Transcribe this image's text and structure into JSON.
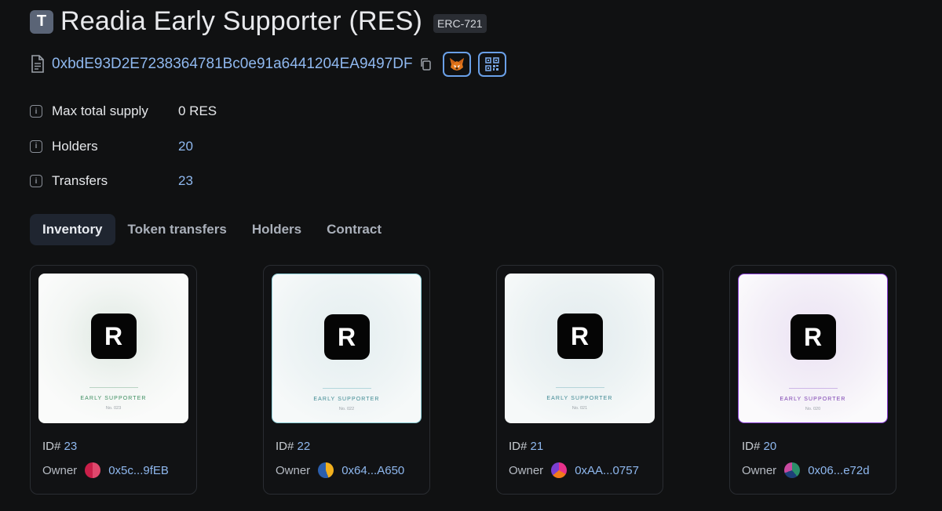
{
  "token": {
    "avatar_letter": "T",
    "title": "Readia Early Supporter (RES)",
    "standard": "ERC-721",
    "address": "0xbdE93D2E7238364781Bc0e91a6441204EA9497DF"
  },
  "icons": {
    "address": "document-icon",
    "copy": "copy-icon",
    "wallet": "metamask-fox-icon",
    "qr": "qr-code-icon",
    "info": "info-icon"
  },
  "stats": [
    {
      "label": "Max total supply",
      "value": "0 RES",
      "link": false
    },
    {
      "label": "Holders",
      "value": "20",
      "link": true
    },
    {
      "label": "Transfers",
      "value": "23",
      "link": true
    }
  ],
  "tabs": [
    {
      "label": "Inventory",
      "active": true
    },
    {
      "label": "Token transfers",
      "active": false
    },
    {
      "label": "Holders",
      "active": false
    },
    {
      "label": "Contract",
      "active": false
    }
  ],
  "inventory": [
    {
      "image_letter": "R",
      "image_title": "EARLY SUPPORTER",
      "image_no": "No. 023",
      "id_label": "ID#",
      "id": "23",
      "owner_label": "Owner",
      "owner": "0x5c...9fEB",
      "accent": "#3f8f62"
    },
    {
      "image_letter": "R",
      "image_title": "EARLY SUPPORTER",
      "image_no": "No. 022",
      "id_label": "ID#",
      "id": "22",
      "owner_label": "Owner",
      "owner": "0x64...A650",
      "accent": "#3f8a93"
    },
    {
      "image_letter": "R",
      "image_title": "EARLY SUPPORTER",
      "image_no": "No. 021",
      "id_label": "ID#",
      "id": "21",
      "owner_label": "Owner",
      "owner": "0xAA...0757",
      "accent": "#3f8993"
    },
    {
      "image_letter": "R",
      "image_title": "EARLY SUPPORTER",
      "image_no": "No. 020",
      "id_label": "ID#",
      "id": "20",
      "owner_label": "Owner",
      "owner": "0x06...e72d",
      "accent": "#7b3fb0"
    }
  ]
}
